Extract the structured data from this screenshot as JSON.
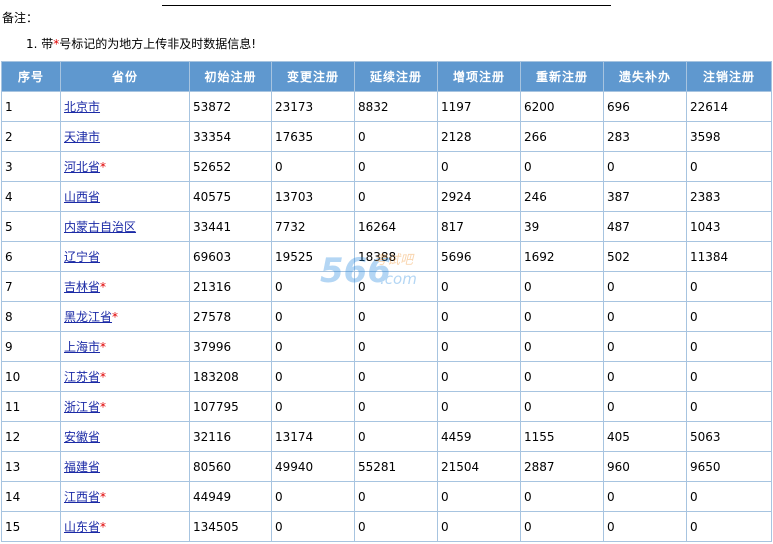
{
  "note": {
    "label": "备注：",
    "item_number": "1.",
    "item_prefix": "带",
    "item_star": "*",
    "item_suffix": "号标记的为地方上传非及时数据信息!"
  },
  "table": {
    "headers": [
      "序号",
      "省份",
      "初始注册",
      "变更注册",
      "延续注册",
      "增项注册",
      "重新注册",
      "遗失补办",
      "注销注册"
    ],
    "rows": [
      {
        "no": "1",
        "province": "北京市",
        "star": "",
        "vals": [
          "53872",
          "23173",
          "8832",
          "1197",
          "6200",
          "696",
          "22614"
        ]
      },
      {
        "no": "2",
        "province": "天津市",
        "star": "",
        "vals": [
          "33354",
          "17635",
          "0",
          "2128",
          "266",
          "283",
          "3598"
        ]
      },
      {
        "no": "3",
        "province": "河北省",
        "star": "*",
        "vals": [
          "52652",
          "0",
          "0",
          "0",
          "0",
          "0",
          "0"
        ]
      },
      {
        "no": "4",
        "province": "山西省",
        "star": "",
        "vals": [
          "40575",
          "13703",
          "0",
          "2924",
          "246",
          "387",
          "2383"
        ]
      },
      {
        "no": "5",
        "province": "内蒙古自治区",
        "star": "",
        "vals": [
          "33441",
          "7732",
          "16264",
          "817",
          "39",
          "487",
          "1043"
        ]
      },
      {
        "no": "6",
        "province": "辽宁省",
        "star": "",
        "vals": [
          "69603",
          "19525",
          "18388",
          "5696",
          "1692",
          "502",
          "11384"
        ]
      },
      {
        "no": "7",
        "province": "吉林省",
        "star": "*",
        "vals": [
          "21316",
          "0",
          "0",
          "0",
          "0",
          "0",
          "0"
        ]
      },
      {
        "no": "8",
        "province": "黑龙江省",
        "star": "*",
        "vals": [
          "27578",
          "0",
          "0",
          "0",
          "0",
          "0",
          "0"
        ]
      },
      {
        "no": "9",
        "province": "上海市",
        "star": "*",
        "vals": [
          "37996",
          "0",
          "0",
          "0",
          "0",
          "0",
          "0"
        ]
      },
      {
        "no": "10",
        "province": "江苏省",
        "star": "*",
        "vals": [
          "183208",
          "0",
          "0",
          "0",
          "0",
          "0",
          "0"
        ]
      },
      {
        "no": "11",
        "province": "浙江省",
        "star": "*",
        "vals": [
          "107795",
          "0",
          "0",
          "0",
          "0",
          "0",
          "0"
        ]
      },
      {
        "no": "12",
        "province": "安徽省",
        "star": "",
        "vals": [
          "32116",
          "13174",
          "0",
          "4459",
          "1155",
          "405",
          "5063"
        ]
      },
      {
        "no": "13",
        "province": "福建省",
        "star": "",
        "vals": [
          "80560",
          "49940",
          "55281",
          "21504",
          "2887",
          "960",
          "9650"
        ]
      },
      {
        "no": "14",
        "province": "江西省",
        "star": "*",
        "vals": [
          "44949",
          "0",
          "0",
          "0",
          "0",
          "0",
          "0"
        ]
      },
      {
        "no": "15",
        "province": "山东省",
        "star": "*",
        "vals": [
          "134505",
          "0",
          "0",
          "0",
          "0",
          "0",
          "0"
        ]
      }
    ]
  },
  "watermark": {
    "text_top": "考试吧",
    "text_bottom": ".com",
    "numerals": "566"
  },
  "colors": {
    "header_bg": "#5f98cf",
    "border": "#a7c4e0",
    "link": "#1b2aa6",
    "star": "#e00000"
  }
}
